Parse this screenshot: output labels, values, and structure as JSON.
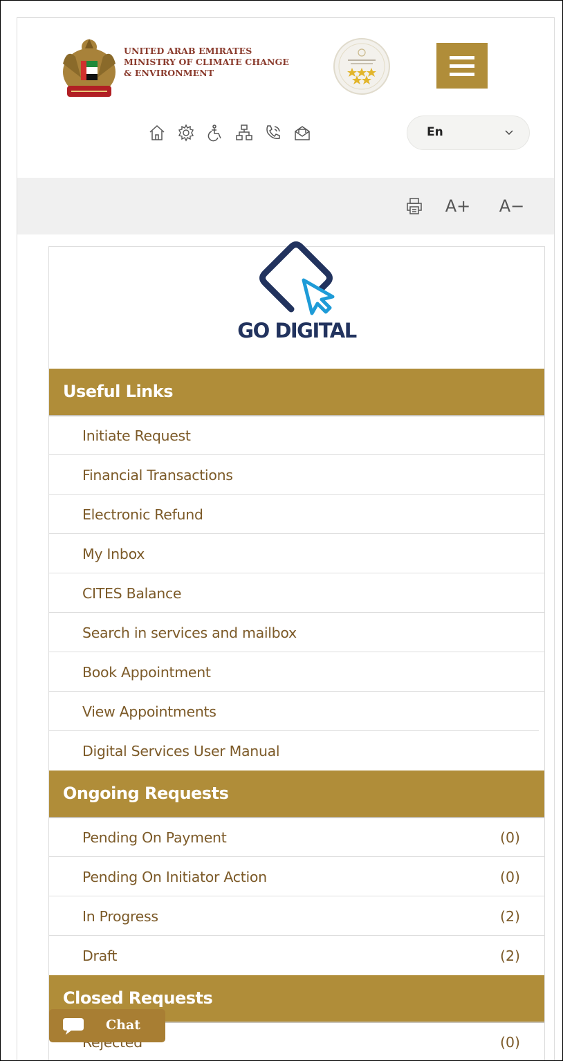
{
  "header": {
    "ministry_lines": [
      "UNITED ARAB EMIRATES",
      "MINISTRY OF CLIMATE CHANGE",
      "& ENVIRONMENT"
    ],
    "tool_icons": [
      "home-icon",
      "settings-icon",
      "accessibility-icon",
      "sitemap-icon",
      "phone-icon",
      "mail-icon"
    ],
    "language": "En",
    "accent_color": "#b08d39"
  },
  "text_tools": {
    "increase": "A+",
    "decrease": "A−"
  },
  "banner": {
    "text": "GO DIGITAL"
  },
  "useful_links": {
    "title": "Useful Links",
    "items": [
      "Initiate Request",
      "Financial Transactions",
      "Electronic Refund",
      "My Inbox",
      "CITES Balance",
      "Search in services and mailbox",
      "Book Appointment",
      "View Appointments",
      "Digital Services User Manual"
    ]
  },
  "ongoing": {
    "title": "Ongoing Requests",
    "items": [
      {
        "label": "Pending On Payment",
        "count": "(0)"
      },
      {
        "label": "Pending On Initiator Action",
        "count": "(0)"
      },
      {
        "label": "In Progress",
        "count": "(2)"
      },
      {
        "label": "Draft",
        "count": "(2)"
      }
    ]
  },
  "closed": {
    "title": "Closed Requests",
    "items": [
      {
        "label": "Rejected",
        "count": "(0)"
      }
    ]
  },
  "chat": {
    "label": "Chat"
  }
}
